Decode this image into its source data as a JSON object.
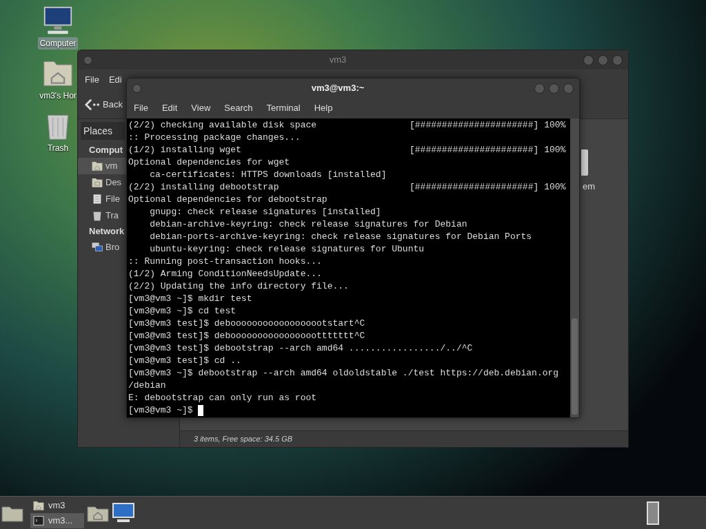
{
  "desktop_icons": [
    {
      "kind": "computer",
      "label": "Computer",
      "selected": true
    },
    {
      "kind": "home",
      "label": "vm3's Hor",
      "selected": false
    },
    {
      "kind": "trash",
      "label": "Trash",
      "selected": false
    }
  ],
  "file_manager": {
    "title": "vm3",
    "menu": [
      "File",
      "Edi"
    ],
    "back_label": "Back",
    "sidebar_tab": "Places",
    "sidebar": [
      {
        "heading": "Comput",
        "items": [
          {
            "kind": "home",
            "label": "vm",
            "selected": true
          },
          {
            "kind": "desktop",
            "label": "Des",
            "selected": false
          },
          {
            "kind": "filesystem",
            "label": "File",
            "selected": false
          },
          {
            "kind": "trash",
            "label": "Tra",
            "selected": false
          }
        ]
      },
      {
        "heading": "Network",
        "items": [
          {
            "kind": "network",
            "label": "Bro",
            "selected": false
          }
        ]
      }
    ],
    "content_item_label": "em",
    "status_bar": "3 items, Free space: 34.5 GB"
  },
  "terminal": {
    "title": "vm3@vm3:~",
    "menu": [
      "File",
      "Edit",
      "View",
      "Search",
      "Terminal",
      "Help"
    ],
    "lines": [
      {
        "text": "(2/2) checking available disk space",
        "bar": "[######################]",
        "percent": "100%"
      },
      {
        "text": ":: Processing package changes..."
      },
      {
        "text": "(1/2) installing wget",
        "bar": "[######################]",
        "percent": "100%"
      },
      {
        "text": "Optional dependencies for wget"
      },
      {
        "text": "    ca-certificates: HTTPS downloads [installed]"
      },
      {
        "text": "(2/2) installing debootstrap",
        "bar": "[######################]",
        "percent": "100%"
      },
      {
        "text": "Optional dependencies for debootstrap"
      },
      {
        "text": "    gnupg: check release signatures [installed]"
      },
      {
        "text": "    debian-archive-keyring: check release signatures for Debian"
      },
      {
        "text": "    debian-ports-archive-keyring: check release signatures for Debian Ports"
      },
      {
        "text": "    ubuntu-keyring: check release signatures for Ubuntu"
      },
      {
        "text": ":: Running post-transaction hooks..."
      },
      {
        "text": "(1/2) Arming ConditionNeedsUpdate..."
      },
      {
        "text": "(2/2) Updating the info directory file..."
      },
      {
        "text": "[vm3@vm3 ~]$ mkdir test"
      },
      {
        "text": "[vm3@vm3 ~]$ cd test"
      },
      {
        "text": "[vm3@vm3 test]$ deboooooooooooooooootstart^C"
      },
      {
        "text": "[vm3@vm3 test]$ deboooooooooooooooottttttt^C"
      },
      {
        "text": "[vm3@vm3 test]$ debootstrap --arch amd64 ................./../^C"
      },
      {
        "text": "[vm3@vm3 test]$ cd .."
      },
      {
        "text": "[vm3@vm3 ~]$ debootstrap --arch amd64 oldoldstable ./test https://deb.debian.org"
      },
      {
        "text": "/debian"
      },
      {
        "text": "E: debootstrap can only run as root"
      },
      {
        "text": "[vm3@vm3 ~]$ ",
        "cursor": true
      }
    ]
  },
  "taskbar": {
    "windows": [
      {
        "kind": "home",
        "label": "vm3",
        "selected": false
      },
      {
        "kind": "terminal",
        "label": "vm3...",
        "selected": true
      }
    ]
  }
}
